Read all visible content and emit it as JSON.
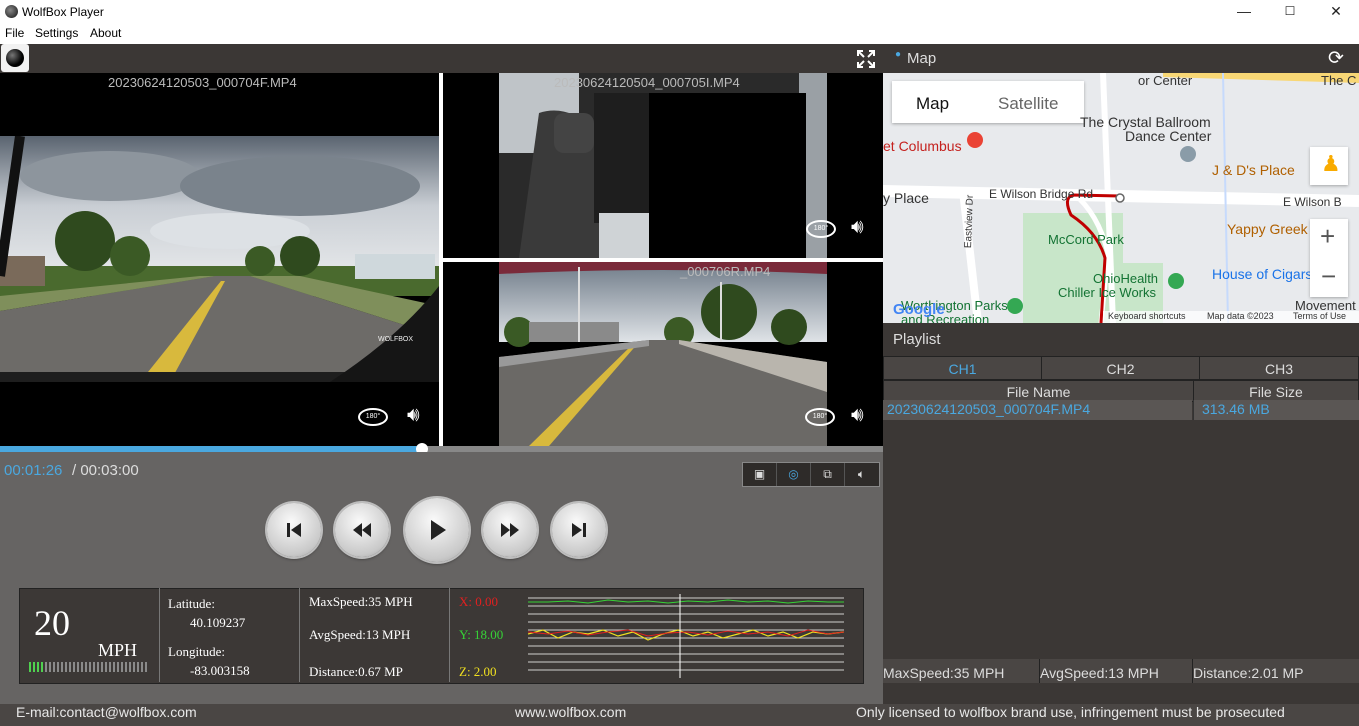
{
  "window": {
    "title": "WolfBox Player",
    "controls": [
      "—",
      "☐",
      "✕"
    ]
  },
  "menu": {
    "items": [
      "File",
      "Settings",
      "About"
    ]
  },
  "videos": {
    "ch1_filename": "20230624120503_000704F.MP4",
    "ch2_filename": "20230624120504_000705I.MP4",
    "ch3_filename": "_000706R.MP4",
    "watermark": "WOLFBOX"
  },
  "playback": {
    "current_time": "00:01:26",
    "total_time": "/ 00:03:00",
    "progress_fraction": 0.478
  },
  "telemetry": {
    "speed": "20",
    "speed_unit": "MPH",
    "speed_level_fraction": 0.12,
    "latitude_label": "Latitude:",
    "latitude": "40.109237",
    "longitude_label": "Longitude:",
    "longitude": "-83.003158",
    "max_speed": "MaxSpeed:35 MPH",
    "avg_speed": "AvgSpeed:13 MPH",
    "distance": "Distance:0.67 MP",
    "x": "X: 0.00",
    "y": "Y: 18.00",
    "z": "Z: 2.00",
    "colors": {
      "x": "#e02020",
      "y": "#36d236",
      "z": "#f0e020"
    }
  },
  "map": {
    "header": "Map",
    "tab_map": "Map",
    "tab_satellite": "Satellite",
    "labels": {
      "crystal_ballroom_1": "The Crystal Ballroom",
      "crystal_ballroom_2": "Dance Center",
      "columbus": "et Columbus",
      "jds": "J & D's Place",
      "place": "y Place",
      "wilson_rd": "E Wilson Bridge Rd",
      "wilson_right": "E Wilson B",
      "eastview": "Eastview Dr",
      "mccord": "McCord Park",
      "yappy": "Yappy Greek",
      "ohiohealth_1": "OhioHealth",
      "ohiohealth_2": "Chiller Ice Works",
      "house_cigars": "House of Cigars",
      "worthington_1": "Worthington Parks",
      "worthington_2": "and Recreation",
      "movement": "Movement La",
      "top_center": "or Center",
      "top_right": "The C",
      "google": "Google",
      "shortcuts": "Keyboard shortcuts",
      "mapdata": "Map data ©2023",
      "terms": "Terms of Use"
    },
    "zoom_in": "+",
    "zoom_out": "−"
  },
  "playlist": {
    "title": "Playlist",
    "channels": [
      "CH1",
      "CH2",
      "CH3"
    ],
    "columns": [
      "File Name",
      "File Size"
    ],
    "rows": [
      {
        "name": "20230624120503_000704F.MP4",
        "size": "313.46 MB"
      }
    ],
    "stats": {
      "max_speed": "MaxSpeed:35 MPH",
      "avg_speed": "AvgSpeed:13 MPH",
      "distance": "Distance:2.01 MP"
    }
  },
  "footer": {
    "email": "E-mail:contact@wolfbox.com",
    "website": "www.wolfbox.com",
    "notice": "Only licensed to wolfbox brand use, infringement must be prosecuted"
  }
}
